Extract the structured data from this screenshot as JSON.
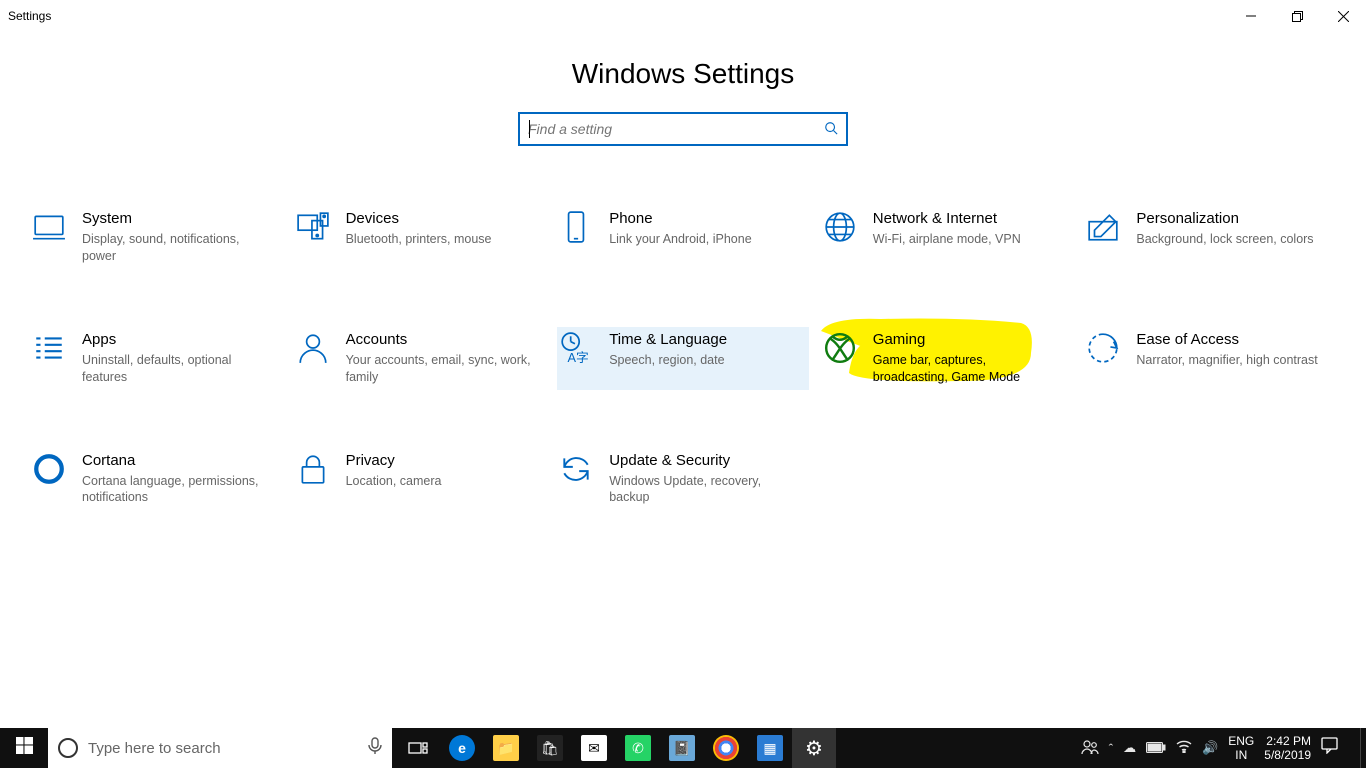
{
  "window": {
    "title": "Settings"
  },
  "page": {
    "heading": "Windows Settings"
  },
  "search": {
    "placeholder": "Find a setting"
  },
  "categories": [
    {
      "key": "system",
      "title": "System",
      "desc": "Display, sound, notifications, power"
    },
    {
      "key": "devices",
      "title": "Devices",
      "desc": "Bluetooth, printers, mouse"
    },
    {
      "key": "phone",
      "title": "Phone",
      "desc": "Link your Android, iPhone"
    },
    {
      "key": "network",
      "title": "Network & Internet",
      "desc": "Wi-Fi, airplane mode, VPN"
    },
    {
      "key": "personalization",
      "title": "Personalization",
      "desc": "Background, lock screen, colors"
    },
    {
      "key": "apps",
      "title": "Apps",
      "desc": "Uninstall, defaults, optional features"
    },
    {
      "key": "accounts",
      "title": "Accounts",
      "desc": "Your accounts, email, sync, work, family"
    },
    {
      "key": "time",
      "title": "Time & Language",
      "desc": "Speech, region, date"
    },
    {
      "key": "gaming",
      "title": "Gaming",
      "desc": "Game bar, captures, broadcasting, Game Mode"
    },
    {
      "key": "ease",
      "title": "Ease of Access",
      "desc": "Narrator, magnifier, high contrast"
    },
    {
      "key": "cortana",
      "title": "Cortana",
      "desc": "Cortana language, permissions, notifications"
    },
    {
      "key": "privacy",
      "title": "Privacy",
      "desc": "Location, camera"
    },
    {
      "key": "update",
      "title": "Update & Security",
      "desc": "Windows Update, recovery, backup"
    }
  ],
  "taskbar": {
    "search_placeholder": "Type here to search",
    "lang_top": "ENG",
    "lang_bottom": "IN",
    "time": "2:42 PM",
    "date": "5/8/2019"
  }
}
